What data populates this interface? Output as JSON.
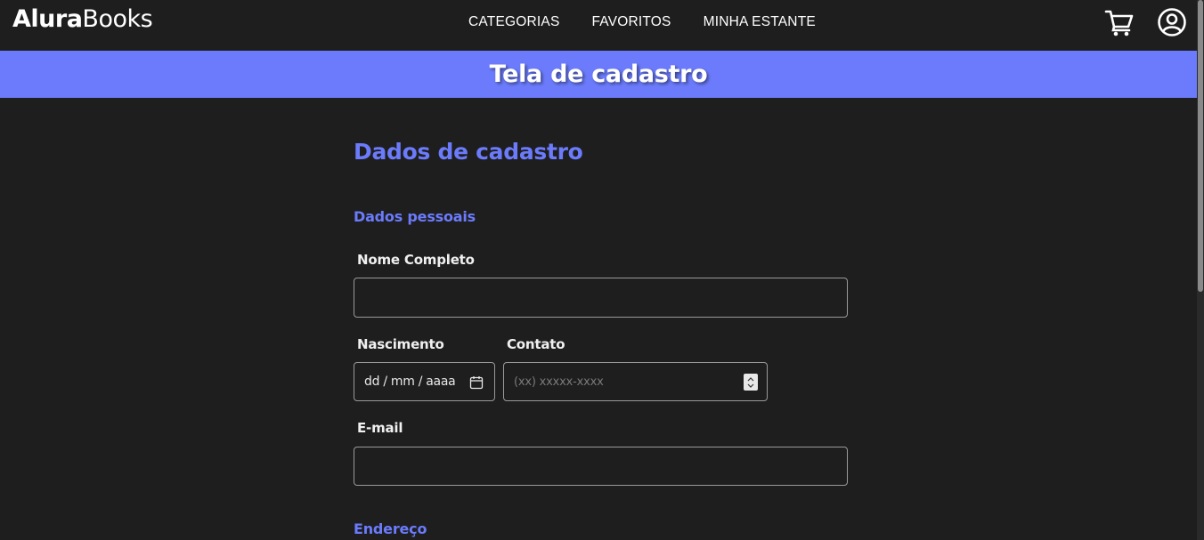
{
  "header": {
    "logo_bold": "Alura",
    "logo_light": "Books",
    "nav": [
      "CATEGORIAS",
      "FAVORITOS",
      "MINHA ESTANTE"
    ],
    "icons": [
      "cart-icon",
      "user-icon"
    ]
  },
  "banner": {
    "title": "Tela de cadastro"
  },
  "form": {
    "title": "Dados de cadastro",
    "section_personal": "Dados pessoais",
    "name_label": "Nome Completo",
    "name_value": "",
    "birth_label": "Nascimento",
    "birth_placeholder": "dd / mm / aaaa",
    "contact_label": "Contato",
    "contact_placeholder": "(xx) xxxxx-xxxx",
    "email_label": "E-mail",
    "email_value": "",
    "section_address": "Endereço"
  },
  "colors": {
    "accent": "#6b7bfb",
    "background": "#1e1e1e",
    "text": "#ffffff"
  }
}
